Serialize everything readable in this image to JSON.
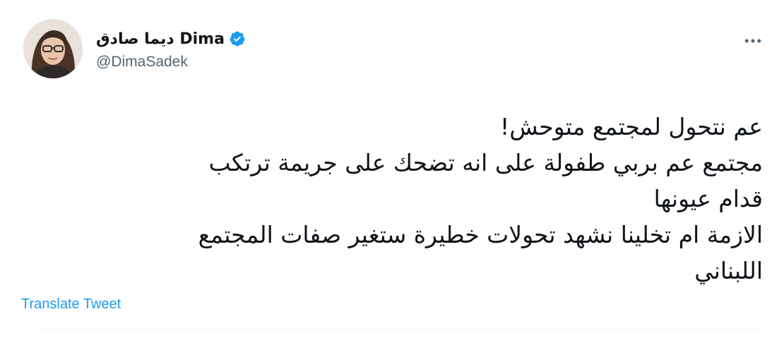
{
  "author": {
    "display_name": "ديما صادق Dima",
    "handle": "@DimaSadek",
    "verified": true,
    "avatar_icon": "profile-photo"
  },
  "tweet": {
    "lines": [
      "عم نتحول لمجتمع متوحش!",
      "مجتمع عم بربي طفولة على انه تضحك على جريمة ترتكب",
      "قدام عيونها",
      "الازمة ام تخلينا نشهد تحولات خطيرة ستغير صفات المجتمع",
      "اللبناني"
    ]
  },
  "actions": {
    "translate_label": "Translate Tweet",
    "more_icon": "more-horizontal-icon"
  },
  "colors": {
    "verified": "#1d9bf0",
    "link": "#1d9bf0",
    "handle": "#536471",
    "text": "#0f1419",
    "divider": "#eff3f4"
  }
}
